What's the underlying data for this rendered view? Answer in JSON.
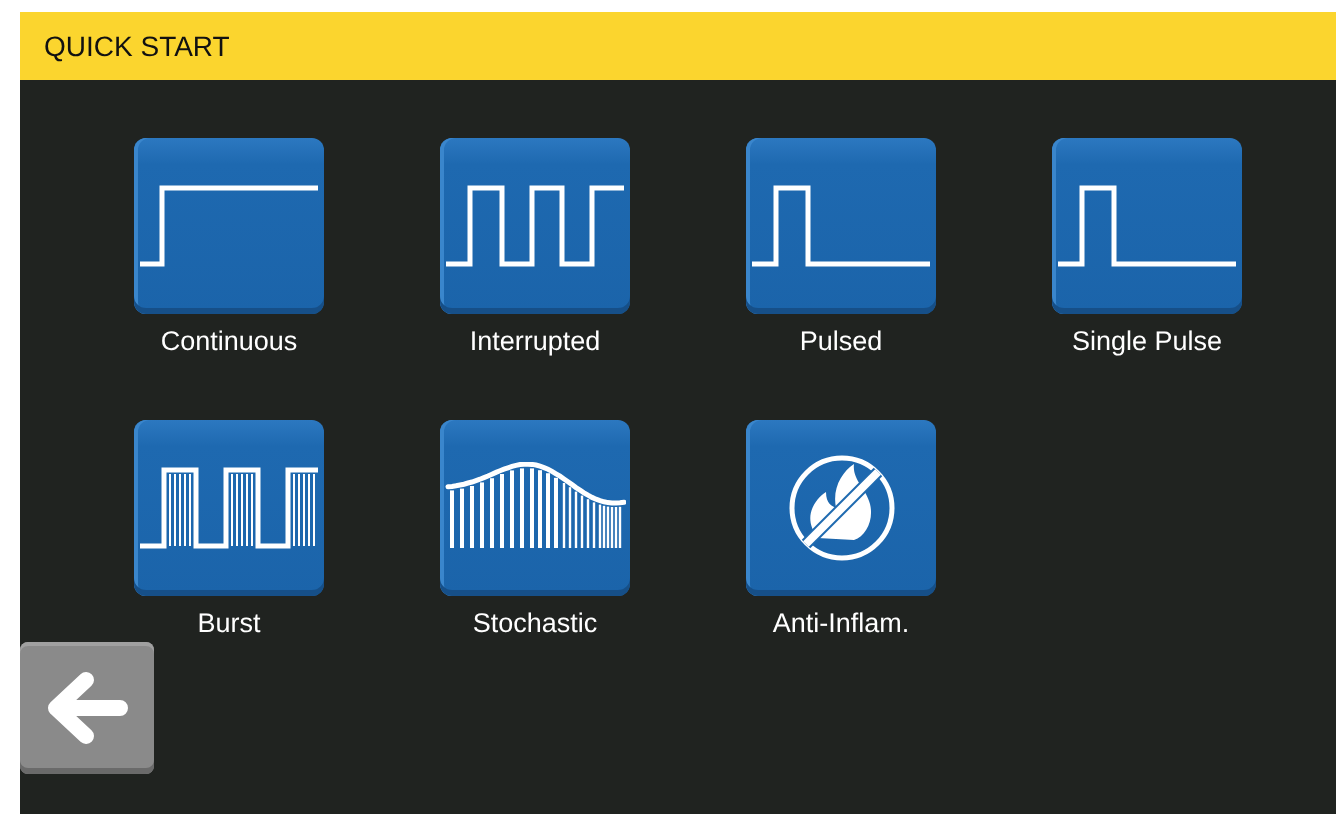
{
  "header": {
    "title": "QUICK START"
  },
  "modes": [
    {
      "label": "Continuous",
      "kind": "continuous"
    },
    {
      "label": "Interrupted",
      "kind": "interrupted"
    },
    {
      "label": "Pulsed",
      "kind": "pulsed"
    },
    {
      "label": "Single Pulse",
      "kind": "pulsed"
    },
    {
      "label": "Burst",
      "kind": "burst"
    },
    {
      "label": "Stochastic",
      "kind": "stochastic"
    },
    {
      "label": "Anti-Inflam.",
      "kind": "anti-inflammatory"
    }
  ]
}
